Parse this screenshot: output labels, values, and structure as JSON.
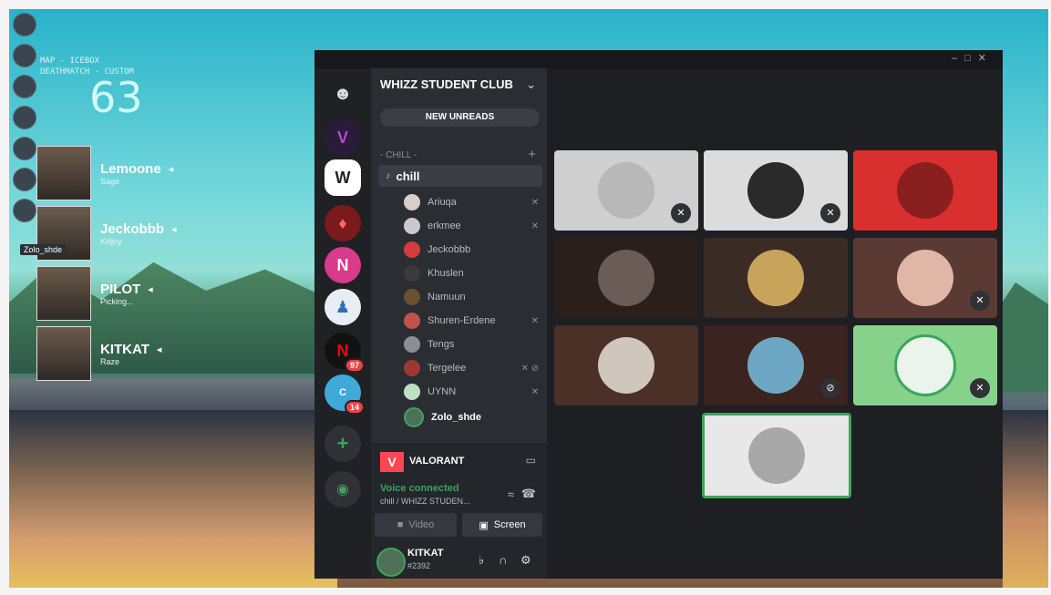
{
  "overlay": {
    "header_line1": "MAP - ICEBOX",
    "header_line2": "DEATHMATCH - CUSTOM",
    "score": "63",
    "players": [
      {
        "name": "Lemoone",
        "sub": "Sage"
      },
      {
        "name": "Jeckobbb",
        "sub": "Killjoy"
      },
      {
        "name": "PILOT",
        "sub": "Picking..."
      },
      {
        "name": "KITKAT",
        "sub": "Raze"
      }
    ],
    "small_tag": "Zolo_shde"
  },
  "server": {
    "name": "WHIZZ STUDENT CLUB",
    "new_unreads": "NEW UNREADS",
    "category": "- CHILL -",
    "voice_channel": "chill",
    "members": [
      "Ariuqa",
      "erkmee",
      "Jeckobbb",
      "Khuslen",
      "Namuun",
      "Shuren-Erdene",
      "Tengs",
      "Tergelee",
      "UYNN",
      "Zolo_shde"
    ]
  },
  "guild_badges": [
    "97",
    "14"
  ],
  "activity": {
    "game": "VALORANT"
  },
  "voice": {
    "status": "Voice connected",
    "channel_path": "chill / WHIZZ STUDEN...",
    "video_label": "Video",
    "screen_label": "Screen"
  },
  "user": {
    "name": "KITKAT",
    "tag": "#2392"
  },
  "colors": {
    "accent_green": "#3ba55c",
    "danger_red": "#ed4245",
    "valorant_red": "#ff4655"
  }
}
